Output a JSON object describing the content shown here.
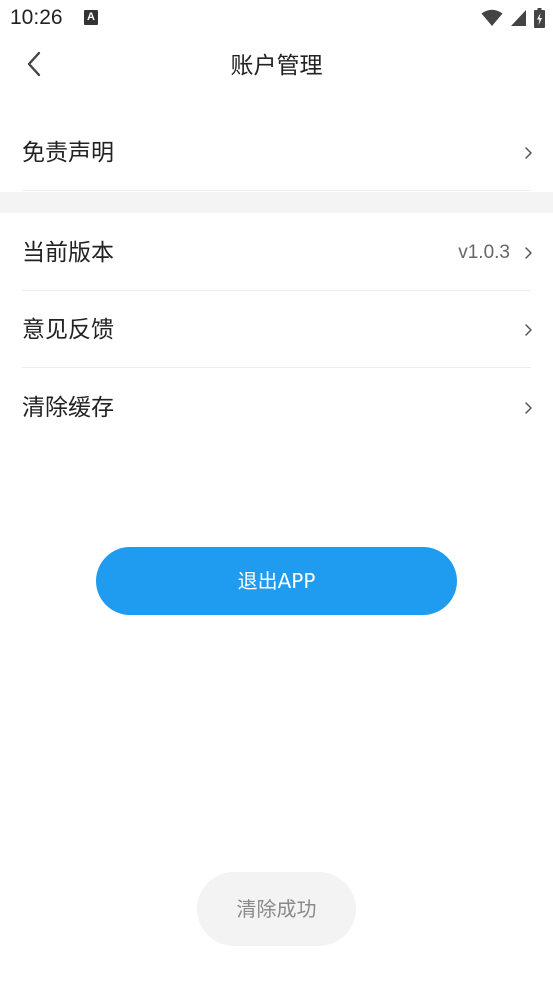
{
  "status_bar": {
    "time": "10:26",
    "notification_icon": "a-letter-icon",
    "icons": [
      "wifi-icon",
      "signal-icon",
      "battery-charging-icon"
    ]
  },
  "header": {
    "title": "账户管理",
    "back_icon": "chevron-left-icon"
  },
  "sections": {
    "first": [
      {
        "label": "免责声明"
      }
    ],
    "second": [
      {
        "label": "当前版本",
        "value": "v1.0.3"
      },
      {
        "label": "意见反馈"
      },
      {
        "label": "清除缓存"
      }
    ]
  },
  "logout": {
    "label": "退出APP",
    "color": "#1f9bf0"
  },
  "toast": {
    "message": "清除成功"
  }
}
